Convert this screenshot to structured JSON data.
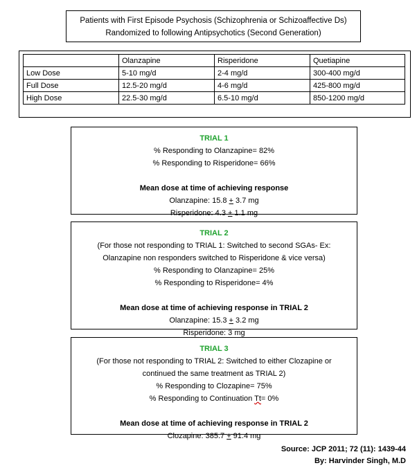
{
  "header": {
    "line1": "Patients with First Episode Psychosis (Schizophrenia or Schizoaffective Ds)",
    "line2": "Randomized to following Antipsychotics (Second Generation)"
  },
  "dose_table": {
    "columns": [
      "",
      "Olanzapine",
      "Risperidone",
      "Quetiapine"
    ],
    "rows": [
      {
        "label": "Low Dose",
        "olanzapine": "5-10 mg/d",
        "risperidone": "2-4 mg/d",
        "quetiapine": "300-400 mg/d"
      },
      {
        "label": "Full Dose",
        "olanzapine": "12.5-20 mg/d",
        "risperidone": "4-6 mg/d",
        "quetiapine": "425-800 mg/d"
      },
      {
        "label": "High Dose",
        "olanzapine": "22.5-30 mg/d",
        "risperidone": "6.5-10 mg/d",
        "quetiapine": "850-1200 mg/d"
      }
    ]
  },
  "trials": [
    {
      "title": "TRIAL 1",
      "responses": [
        "% Responding to Olanzapine= 82%",
        "% Responding to Risperidone= 66%"
      ],
      "dose_heading": "Mean dose at time of achieving response",
      "doses": [
        {
          "drug": "Olanzapine: 15.8 ",
          "pm": "+",
          "rest": " 3.7 mg"
        },
        {
          "drug": "Risperidone: 4.3 ",
          "pm": "+",
          "rest": " 1.1 mg"
        }
      ]
    },
    {
      "title": "TRIAL 2",
      "note_line1": "(For those not responding to TRIAL 1: Switched to second SGAs- Ex:",
      "note_line2": "Olanzapine non responders switched to Risperidone & vice versa)",
      "responses": [
        "% Responding to Olanzapine= 25%",
        "% Responding to Risperidone= 4%"
      ],
      "dose_heading": "Mean dose at time of achieving response in TRIAL 2",
      "doses": [
        {
          "drug": "Olanzapine: 15.3 ",
          "pm": "+",
          "rest": " 3.2 mg"
        },
        {
          "drug": "Risperidone: 3 mg"
        }
      ]
    },
    {
      "title": "TRIAL 3",
      "note_line1": "(For those not responding to TRIAL 2: Switched to either Clozapine or",
      "note_line2": "continued the same treatment as TRIAL 2)",
      "responses": [
        "% Responding to Clozapine= 75%"
      ],
      "response_cont_pre": "% Responding to Continuation ",
      "response_cont_word": "Tt",
      "response_cont_post": "= 0%",
      "dose_heading": "Mean dose at time of achieving response in TRIAL 2",
      "doses": [
        {
          "drug": "Clozapine: 385.7 ",
          "pm": "+",
          "rest": " 91.4 mg"
        }
      ]
    }
  ],
  "footer": {
    "source": "Source: JCP 2011; 72 (11): 1439-44",
    "author": "By: Harvinder Singh,  M.D"
  },
  "colors": {
    "trial_title": "#1fa22e",
    "border": "#000000"
  }
}
